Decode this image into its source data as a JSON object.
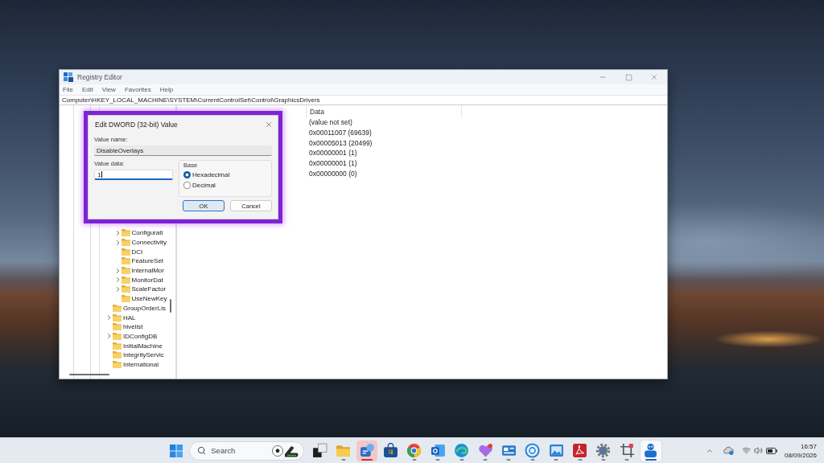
{
  "window": {
    "title": "Registry Editor",
    "menu": [
      "File",
      "Edit",
      "View",
      "Favorites",
      "Help"
    ],
    "address": "Computer\\HKEY_LOCAL_MACHINE\\SYSTEM\\CurrentControlSet\\Control\\GraphicsDrivers"
  },
  "tree": {
    "items": [
      {
        "children": [
          {
            "label": "Configurati",
            "kind": "branch",
            "expanded": false
          },
          {
            "label": "Connectivity",
            "kind": "branch",
            "expanded": false
          },
          {
            "label": "DCI",
            "kind": "leaf"
          },
          {
            "label": "FeatureSet",
            "kind": "leaf"
          },
          {
            "label": "InternalMor",
            "kind": "branch",
            "expanded": false
          },
          {
            "label": "MonitorDat",
            "kind": "branch",
            "expanded": false
          },
          {
            "label": "ScaleFactor",
            "kind": "branch",
            "expanded": false
          },
          {
            "label": "UseNewKey",
            "kind": "leaf"
          }
        ]
      },
      {
        "label": "GroupOrderLis",
        "kind": "leaf"
      },
      {
        "label": "HAL",
        "kind": "branch",
        "expanded": false
      },
      {
        "label": "hivelist",
        "kind": "leaf"
      },
      {
        "label": "IDConfigDB",
        "kind": "branch",
        "expanded": false
      },
      {
        "label": "InitialMachine",
        "kind": "leaf"
      },
      {
        "label": "IntegrityServic",
        "kind": "leaf"
      },
      {
        "label": "International",
        "kind": "leaf"
      }
    ]
  },
  "values": {
    "heading": "Data",
    "rows": [
      "(value not set)",
      "0x00011007 (69639)",
      "0x00005013 (20499)",
      "0x00000001 (1)",
      "0x00000001 (1)",
      "0x00000000 (0)"
    ]
  },
  "dialog": {
    "title": "Edit DWORD (32-bit) Value",
    "value_name_label": "Value name:",
    "value_name": "DisableOverlays",
    "value_data_label": "Value data:",
    "value_data": "1",
    "base": {
      "label": "Base",
      "options": [
        {
          "label": "Hexadecimal",
          "selected": true
        },
        {
          "label": "Decimal",
          "selected": false
        }
      ]
    },
    "buttons": [
      {
        "label": "OK",
        "default": true
      },
      {
        "label": "Cancel",
        "default": false
      }
    ]
  },
  "taskbar": {
    "search": {
      "placeholder": "Search"
    },
    "apps": [
      {
        "kind": "taskview",
        "running": false,
        "selected": false,
        "flashing": false
      },
      {
        "kind": "folder",
        "running": true,
        "selected": false,
        "flashing": false
      },
      {
        "kind": "chat",
        "running": true,
        "selected": false,
        "flashing": true
      },
      {
        "kind": "store",
        "running": false,
        "selected": false,
        "flashing": false
      },
      {
        "kind": "tricolor",
        "running": true,
        "selected": false,
        "flashing": false
      },
      {
        "kind": "mail",
        "running": true,
        "selected": false,
        "flashing": false
      },
      {
        "kind": "swirl",
        "running": true,
        "selected": false,
        "flashing": false
      },
      {
        "kind": "heart",
        "running": true,
        "selected": false,
        "flashing": false
      },
      {
        "kind": "board",
        "running": true,
        "selected": false,
        "flashing": false
      },
      {
        "kind": "ring",
        "running": true,
        "selected": false,
        "flashing": false
      },
      {
        "kind": "picture",
        "running": true,
        "selected": false,
        "flashing": false
      },
      {
        "kind": "document",
        "running": true,
        "selected": false,
        "flashing": false
      },
      {
        "kind": "gear",
        "running": true,
        "selected": false,
        "flashing": false
      },
      {
        "kind": "crop",
        "running": true,
        "selected": false,
        "flashing": false
      },
      {
        "kind": "bot",
        "running": true,
        "selected": true,
        "flashing": false
      }
    ],
    "tray": {
      "time": "16:57",
      "date": "08/09/2026"
    }
  }
}
